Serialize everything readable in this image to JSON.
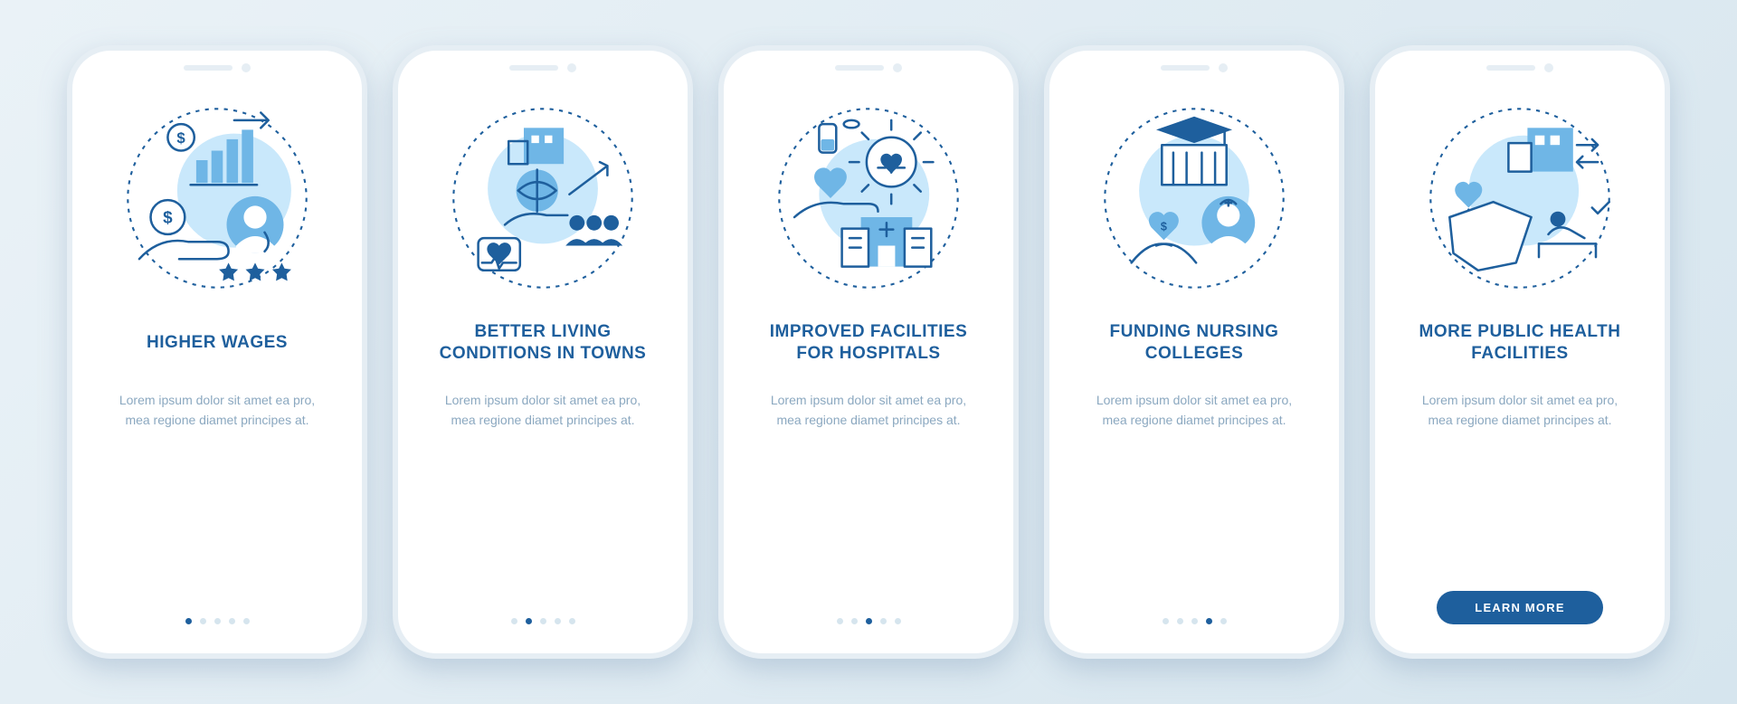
{
  "colors": {
    "brand": "#1E5F9D",
    "brand_light": "#6FB6E6",
    "brand_pale": "#C9E8FB"
  },
  "common": {
    "body": "Lorem ipsum dolor sit amet ea pro, mea regione diamet principes at.",
    "dot_count": 5
  },
  "cta": {
    "label": "LEARN MORE"
  },
  "screens": [
    {
      "title": "HIGHER WAGES",
      "icon": "wages-icon",
      "active_dot": 0,
      "has_cta": false
    },
    {
      "title": "BETTER LIVING CONDITIONS IN TOWNS",
      "icon": "living-conditions-icon",
      "active_dot": 1,
      "has_cta": false
    },
    {
      "title": "IMPROVED FACILITIES FOR HOSPITALS",
      "icon": "hospital-facilities-icon",
      "active_dot": 2,
      "has_cta": false
    },
    {
      "title": "FUNDING NURSING COLLEGES",
      "icon": "nursing-funding-icon",
      "active_dot": 3,
      "has_cta": false
    },
    {
      "title": "MORE PUBLIC HEALTH FACILITIES",
      "icon": "public-health-icon",
      "active_dot": 4,
      "has_cta": true
    }
  ]
}
